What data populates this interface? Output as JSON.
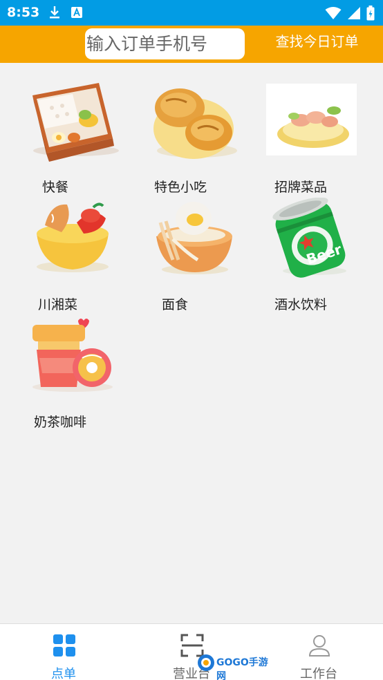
{
  "status_bar": {
    "time": "8:53",
    "icons": [
      "download-icon",
      "a-notification-icon",
      "wifi-icon",
      "signal-icon",
      "battery-icon"
    ]
  },
  "header": {
    "search_placeholder": "输入订单手机号",
    "search_value": "",
    "find_button_label": "查找今日订单",
    "color": "#f6a500"
  },
  "categories": [
    {
      "label": "快餐",
      "icon": "bento-box-icon"
    },
    {
      "label": "特色小吃",
      "icon": "bread-basket-icon"
    },
    {
      "label": "招牌菜品",
      "icon": "shrimp-dish-icon"
    },
    {
      "label": "川湘菜",
      "icon": "spicy-dish-icon"
    },
    {
      "label": "面食",
      "icon": "noodle-bowl-icon"
    },
    {
      "label": "酒水饮料",
      "icon": "beer-can-icon"
    },
    {
      "label": "奶茶咖啡",
      "icon": "milk-tea-icon"
    }
  ],
  "bottom_nav": {
    "items": [
      {
        "label": "点单",
        "icon": "grid-icon",
        "active": true
      },
      {
        "label": "营业台",
        "icon": "scan-icon",
        "active": false
      },
      {
        "label": "工作台",
        "icon": "user-icon",
        "active": false
      }
    ],
    "active_color": "#1e90ee"
  },
  "watermark": {
    "text": "GOGO手游网"
  }
}
